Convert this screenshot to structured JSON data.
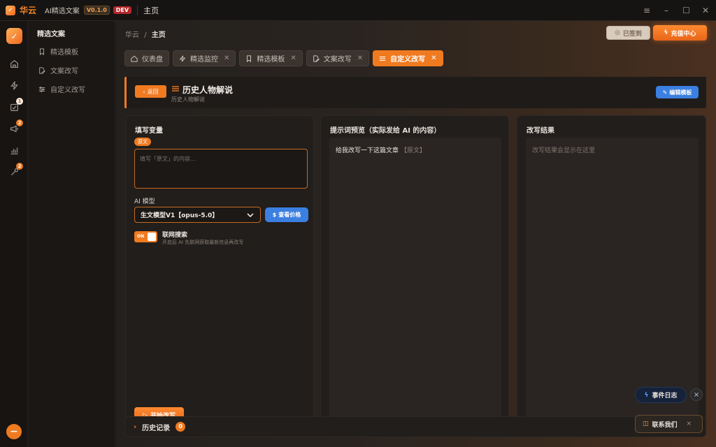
{
  "titlebar": {
    "brand": "华云",
    "product": "AI精选文案",
    "version": "V0.1.0",
    "env": "DEV",
    "page": "主页",
    "logo_glyph": "✓"
  },
  "rail": {
    "logo_glyph": "✓",
    "badges": {
      "tasks": "1",
      "announce": "2",
      "tools": "2"
    },
    "minus": "−"
  },
  "sidebar": {
    "title": "精选文案",
    "items": [
      {
        "label": "精选模板",
        "icon": "bookmark-icon"
      },
      {
        "label": "文案改写",
        "icon": "edit-doc-icon"
      },
      {
        "label": "自定义改写",
        "icon": "sliders-icon"
      }
    ]
  },
  "breadcrumb": {
    "root": "华云",
    "sep": "/",
    "current": "主页"
  },
  "actions": {
    "signed": "已签到",
    "recharge": "充值中心"
  },
  "tabs": [
    {
      "label": "仪表盘",
      "closable": false,
      "active": false
    },
    {
      "label": "精选监控",
      "closable": true,
      "active": false
    },
    {
      "label": "精选模板",
      "closable": true,
      "active": false
    },
    {
      "label": "文案改写",
      "closable": true,
      "active": false
    },
    {
      "label": "自定义改写",
      "closable": true,
      "active": true
    }
  ],
  "header": {
    "back": "返回",
    "title": "历史人物解说",
    "subtitle": "历史人物解说",
    "edit": "编辑模板"
  },
  "variables": {
    "title": "填写变量",
    "tag": "原文",
    "placeholder": "填写「原文」的内容...",
    "model_label": "AI 模型",
    "model_value": "生文模型V1【opus-5.0】",
    "price": "查看价格",
    "toggle_state": "ON",
    "search_title": "联网搜索",
    "search_desc": "开启后 AI 先联网获取最新信息再改写",
    "start": "开始改写"
  },
  "preview": {
    "title": "提示词预览（实际发给 AI 的内容）",
    "text": "给我改写一下这篇文章",
    "var": "【原文】"
  },
  "result": {
    "title": "改写结果",
    "placeholder": "改写结果会显示在这里"
  },
  "history": {
    "label": "历史记录",
    "count": "0"
  },
  "floating": {
    "eventlog": "事件日志",
    "contact": "联系我们",
    "close": "×"
  },
  "colors": {
    "accent": "#f07a20",
    "blue": "#3b7fe0"
  }
}
